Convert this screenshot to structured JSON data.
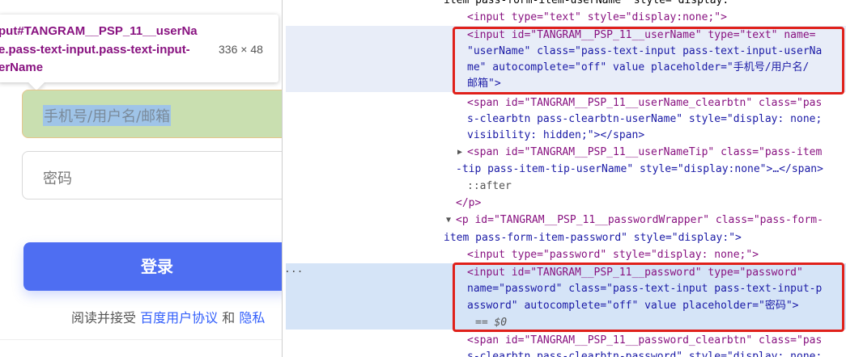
{
  "tooltip": {
    "line1": "put#TANGRAM__PSP_11__userNa",
    "line2": "e.pass-text-input.pass-text-input-",
    "line3": "erName",
    "size": "336 × 48"
  },
  "login": {
    "username_placeholder": "手机号/用户名/邮箱",
    "password_placeholder": "密码",
    "submit_label": "登录",
    "agree_prefix": "阅读并接受",
    "agree_link1": "百度用户协议",
    "agree_and": "和",
    "agree_link2": "隐私"
  },
  "devtools": {
    "ellipsis": "...",
    "dollar": "== $0",
    "lines": {
      "l0": "item pass-form-item-userName\" style=\"display:",
      "l1": "<input type=\"text\" style=\"display:none;\">",
      "u1": "<input id=\"TANGRAM__PSP_11__userName\" type=\"text\" name=",
      "u2": "\"userName\" class=\"pass-text-input pass-text-input-userNa",
      "u3": "me\" autocomplete=\"off\" value placeholder=\"手机号/用户名/",
      "u4": "邮箱\">",
      "c1": "<span id=\"TANGRAM__PSP_11__userName_clearbtn\" class=\"pas",
      "c2": "s-clearbtn pass-clearbtn-userName\" style=\"display: none;",
      "c3": "visibility: hidden;\"></span>",
      "t1": "<span id=\"TANGRAM__PSP_11__userNameTip\" class=\"pass-item",
      "t2": "-tip pass-item-tip-userName\" style=\"display:none\">…</span>",
      "after": "::after",
      "pclose": "</p>",
      "p1": "<p id=\"TANGRAM__PSP_11__passwordWrapper\" class=\"pass-form-",
      "p2": "item pass-form-item-password\" style=\"display:\">",
      "p3": "<input type=\"password\" style=\"display: none;\">",
      "w1": "<input id=\"TANGRAM__PSP_11__password\" type=\"password\"",
      "w2": "name=\"password\" class=\"pass-text-input pass-text-input-p",
      "w3": "assword\" autocomplete=\"off\" value placeholder=\"密码\">",
      "x1": "<span id=\"TANGRAM__PSP_11__password_clearbtn\" class=\"pas",
      "x2": "s-clearbtn pass-clearbtn-password\" style=\"display: none;"
    }
  }
}
